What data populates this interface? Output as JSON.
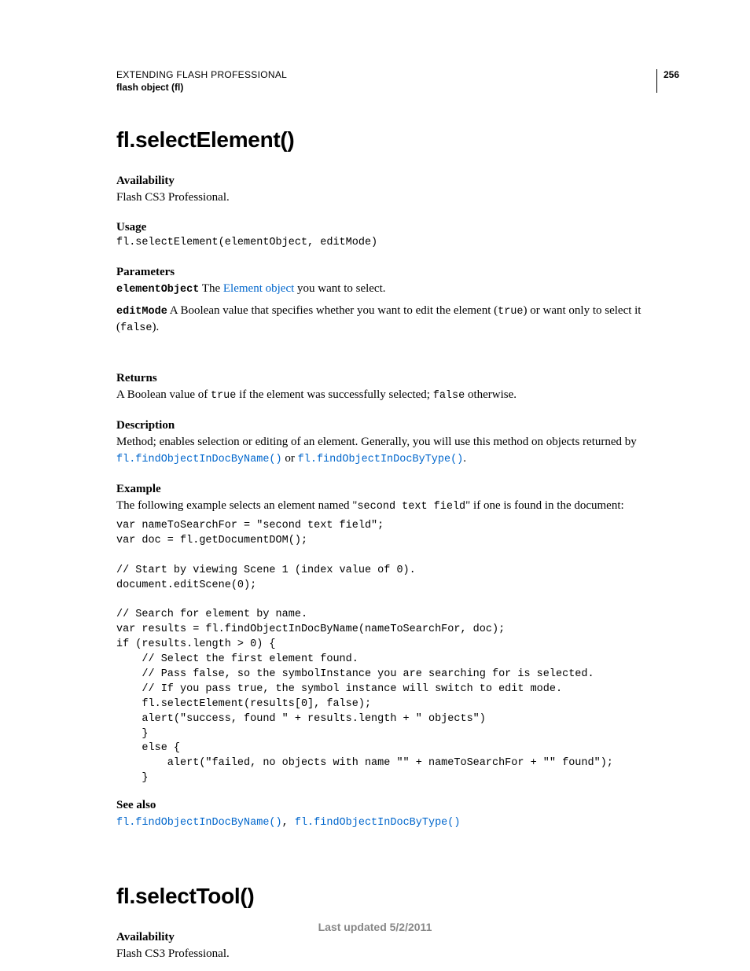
{
  "header": {
    "running_head": "EXTENDING FLASH PROFESSIONAL",
    "running_sub": "flash object (fl)",
    "page_number": "256"
  },
  "section1": {
    "title": "fl.selectElement()",
    "availability": {
      "label": "Availability",
      "text": "Flash CS3 Professional."
    },
    "usage": {
      "label": "Usage",
      "code": "fl.selectElement(elementObject, editMode)"
    },
    "parameters": {
      "label": "Parameters",
      "param1_name": "elementObject",
      "param1_text_pre": "  The ",
      "param1_link": "Element object",
      "param1_text_post": " you want to select.",
      "param2_name": "editMode",
      "param2_text_a": "  A Boolean value that specifies whether you want to edit the element (",
      "param2_code1": "true",
      "param2_text_b": ") or want only to select it (",
      "param2_code2": "false",
      "param2_text_c": ")."
    },
    "returns": {
      "label": "Returns",
      "text_a": "A Boolean value of ",
      "code1": "true",
      "text_b": " if the element was successfully selected; ",
      "code2": "false",
      "text_c": " otherwise."
    },
    "description": {
      "label": "Description",
      "text": "Method; enables selection or editing of an element. Generally, you will use this method on objects returned by ",
      "link1": "fl.findObjectInDocByName()",
      "or": " or ",
      "link2": "fl.findObjectInDocByType()",
      "period": "."
    },
    "example": {
      "label": "Example",
      "intro_a": "The following example selects an element named \"",
      "intro_code": "second text field",
      "intro_b": "\" if one is found in the document:",
      "code": "var nameToSearchFor = \"second text field\";\nvar doc = fl.getDocumentDOM();\n\n// Start by viewing Scene 1 (index value of 0).\ndocument.editScene(0);\n\n// Search for element by name.\nvar results = fl.findObjectInDocByName(nameToSearchFor, doc);\nif (results.length > 0) {\n    // Select the first element found.\n    // Pass false, so the symbolInstance you are searching for is selected.\n    // If you pass true, the symbol instance will switch to edit mode.\n    fl.selectElement(results[0], false);\n    alert(\"success, found \" + results.length + \" objects\")\n    }\n    else {\n        alert(\"failed, no objects with name \"\" + nameToSearchFor + \"\" found\");\n    }"
    },
    "seealso": {
      "label": "See also",
      "link1": "fl.findObjectInDocByName()",
      "comma": ", ",
      "link2": "fl.findObjectInDocByType()"
    }
  },
  "section2": {
    "title": "fl.selectTool()",
    "availability": {
      "label": "Availability",
      "text": "Flash CS3 Professional."
    }
  },
  "footer": {
    "text": "Last updated 5/2/2011"
  }
}
